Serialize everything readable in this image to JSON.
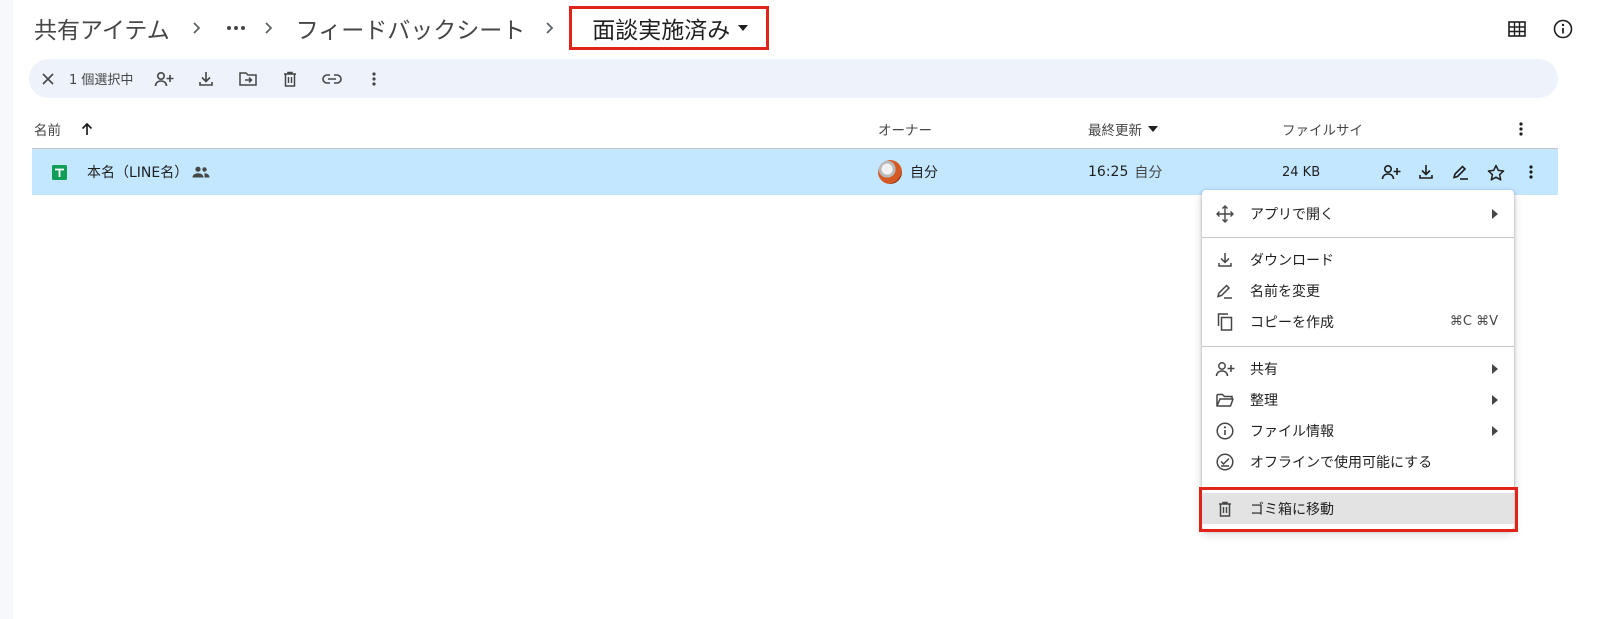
{
  "breadcrumb": {
    "root": "共有アイテム",
    "parent": "フィードバックシート",
    "current": "面談実施済み"
  },
  "header_icons": [
    "grid-view-icon",
    "info-icon"
  ],
  "selection_bar": {
    "count_label": "1 個選択中",
    "actions": [
      "share-icon",
      "download-icon",
      "move-icon",
      "trash-icon",
      "link-icon",
      "more-vert-icon"
    ]
  },
  "columns": {
    "name": "名前",
    "owner": "オーナー",
    "modified": "最終更新",
    "size": "ファイルサイ"
  },
  "file": {
    "name": "本名（LINE名）",
    "owner": "自分",
    "modified_time": "16:25",
    "modified_by": "自分",
    "size": "24 KB"
  },
  "context_menu": {
    "open_with": "アプリで開く",
    "download": "ダウンロード",
    "rename": "名前を変更",
    "copy": "コピーを作成",
    "copy_shortcut": "⌘C ⌘V",
    "share": "共有",
    "organize": "整理",
    "file_info": "ファイル情報",
    "offline": "オフラインで使用可能にする",
    "trash": "ゴミ箱に移動"
  },
  "colors": {
    "selected_row": "#c2e7ff",
    "toolbar_bg": "#eef2fb",
    "highlight_border": "#e2231a",
    "sheets_green": "#0f9d58"
  }
}
